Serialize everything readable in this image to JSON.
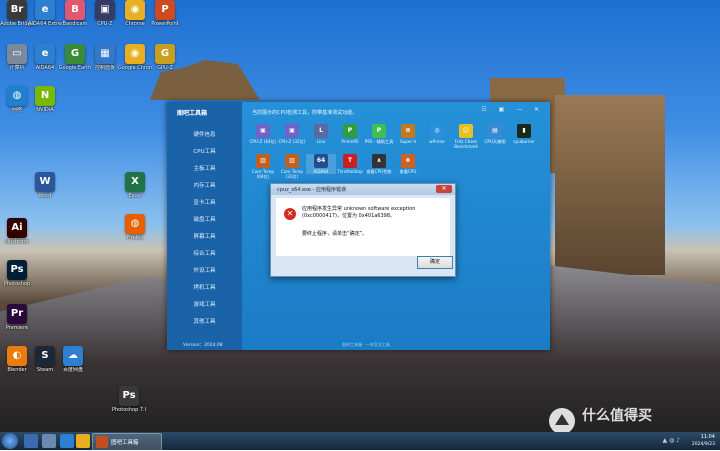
{
  "desktop": {
    "icons": [
      {
        "label": "Adobe Bridge",
        "color": "#3a3a3a",
        "glyph": "Br"
      },
      {
        "label": "AIDA64 Extreme",
        "color": "#2d7fd0",
        "glyph": "e"
      },
      {
        "label": "Bandicam",
        "color": "#e05870",
        "glyph": "B"
      },
      {
        "label": "CPU-Z",
        "color": "#333c66",
        "glyph": "▣"
      },
      {
        "label": "Chrome",
        "color": "#e8b020",
        "glyph": "◉"
      },
      {
        "label": "PowerPoint",
        "color": "#d04a20",
        "glyph": "P"
      },
      {
        "label": "计算机",
        "color": "#7a8a9a",
        "glyph": "▭"
      },
      {
        "label": "AIDA64",
        "color": "#2d7fd0",
        "glyph": "e"
      },
      {
        "label": "Google Earth",
        "color": "#3a8a3a",
        "glyph": "G"
      },
      {
        "label": "控制面板",
        "color": "#3577c8",
        "glyph": "▦"
      },
      {
        "label": "Google Chrome",
        "color": "#e8b020",
        "glyph": "◉"
      },
      {
        "label": "GPU-Z",
        "color": "#c8a020",
        "glyph": "G"
      },
      {
        "label": "网络",
        "color": "#2080d0",
        "glyph": "◍"
      },
      {
        "label": "NVIDIA",
        "color": "#76b900",
        "glyph": "N"
      },
      {
        "label": "Word",
        "color": "#2b579a",
        "glyph": "W"
      },
      {
        "label": "Excel",
        "color": "#217346",
        "glyph": "X"
      },
      {
        "label": "Photoshop",
        "color": "#001e36",
        "glyph": "Ps"
      },
      {
        "label": "Firefox",
        "color": "#e66000",
        "glyph": "◍"
      },
      {
        "label": "Illustrator",
        "color": "#330000",
        "glyph": "Ai"
      },
      {
        "label": "Premiere",
        "color": "#2a0a3a",
        "glyph": "Pr"
      },
      {
        "label": "Blender",
        "color": "#e87d0d",
        "glyph": "◐"
      },
      {
        "label": "Steam",
        "color": "#1b2838",
        "glyph": "S"
      },
      {
        "label": "百度网盘",
        "color": "#2d7fd0",
        "glyph": "☁"
      },
      {
        "label": "Photoshop 7.0",
        "color": "#3a3a3a",
        "glyph": "Ps"
      }
    ]
  },
  "app": {
    "title": "图吧工具箱",
    "notice": "当前展示的CPU检测工具，附带基准测试功能。",
    "version": "Version：2024.08",
    "footer": "图吧工具箱 · 一本官方工具",
    "sidebar": [
      "硬件信息",
      "CPU工具",
      "主板工具",
      "内存工具",
      "显卡工具",
      "磁盘工具",
      "屏幕工具",
      "综合工具",
      "外设工具",
      "烤机工具",
      "游戏工具",
      "其他工具"
    ],
    "tools": [
      {
        "label": "CPU-Z (64位)",
        "color": "#6f63c8",
        "glyph": "▣"
      },
      {
        "label": "CPU-Z (32位)",
        "color": "#6f63c8",
        "glyph": "▣"
      },
      {
        "label": "Linx",
        "color": "#5a6aa0",
        "glyph": "L"
      },
      {
        "label": "Prime95",
        "color": "#2f9d3f",
        "glyph": "P"
      },
      {
        "label": "P95 · 辅助工具",
        "color": "#3fbf4f",
        "glyph": "P"
      },
      {
        "label": "Super π",
        "color": "#c07a20",
        "glyph": "π"
      },
      {
        "label": "wPrime",
        "color": "#2a8fdf",
        "glyph": "◎"
      },
      {
        "label": "Fritz Chess Benchmark",
        "color": "#e8c020",
        "glyph": "☺"
      },
      {
        "label": "CPU天梯图",
        "color": "#3a8ad0",
        "glyph": "▤"
      },
      {
        "label": "cpuburner",
        "color": "#1a2a1a",
        "glyph": "▮"
      },
      {
        "label": "Core Temp (64位)",
        "color": "#c06020",
        "glyph": "▥"
      },
      {
        "label": "Core Temp (32位)",
        "color": "#c06020",
        "glyph": "▥"
      },
      {
        "label": "AIDA64",
        "color": "#1f4f8f",
        "glyph": "64"
      },
      {
        "label": "ThrottleStop",
        "color": "#c82020",
        "glyph": "T"
      },
      {
        "label": "查看CPU性能",
        "color": "#333333",
        "glyph": "∧"
      },
      {
        "label": "查看CPU",
        "color": "#d06020",
        "glyph": "❀"
      }
    ],
    "controls": "☷ ▣ — ✕"
  },
  "dialog": {
    "title": "cpuz_x64.exe - 应用程序错误",
    "message": "应用程序发生异常 unknown software exception (0xc0000417)，位置为 0x401a6398。",
    "instruction": "要终止程序，请单击“确定”。",
    "ok_label": "确定",
    "close_glyph": "✕"
  },
  "taskbar": {
    "active_app": "图吧工具箱",
    "time": "11:04",
    "date": "2024/9/23",
    "tray_icons": "▲ ◍ ♪"
  },
  "watermark": "什么值得买",
  "colors": {
    "accent": "#1c80cc",
    "sidebar": "#1a63a8",
    "error": "#d22a1e"
  }
}
